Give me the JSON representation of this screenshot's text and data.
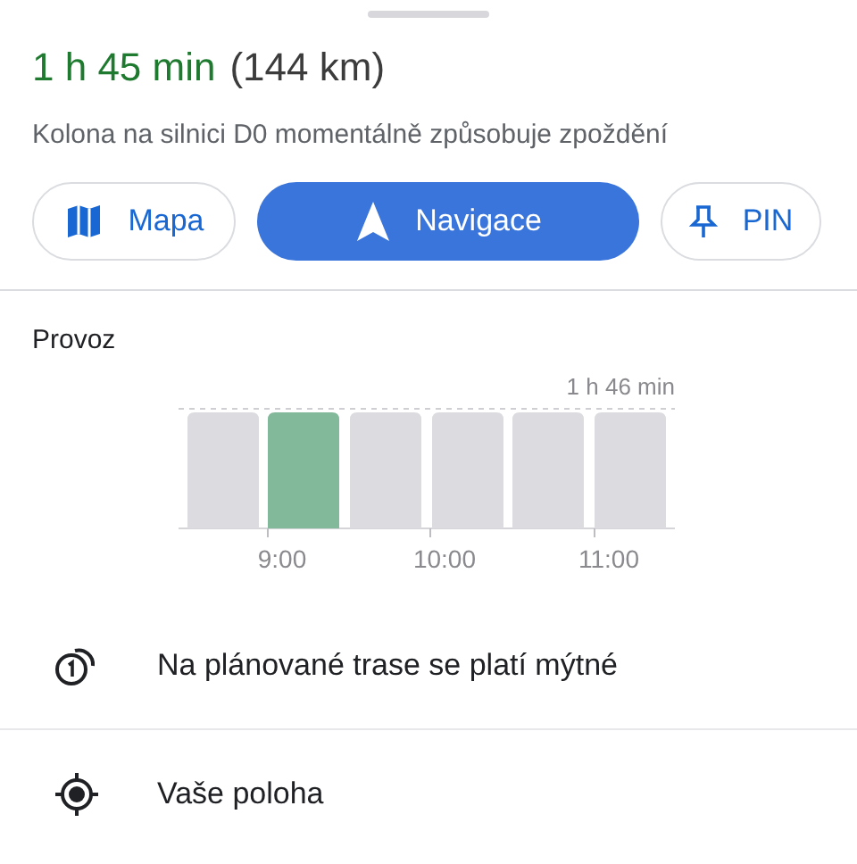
{
  "summary": {
    "duration": "1 h 45 min",
    "distance": "(144 km)",
    "note": "Kolona na silnici D0 momentálně způsobuje zpoždění"
  },
  "buttons": [
    {
      "kind": "map",
      "label": "Mapa"
    },
    {
      "kind": "navigate",
      "label": "Navigace"
    },
    {
      "kind": "pin",
      "label": "PIN"
    }
  ],
  "traffic": {
    "title": "Provoz",
    "max_label": "1 h 46 min",
    "bars": [
      {
        "selected": false
      },
      {
        "selected": true
      },
      {
        "selected": false
      },
      {
        "selected": false
      },
      {
        "selected": false
      },
      {
        "selected": false
      }
    ],
    "times": [
      "9:00",
      "10:00",
      "11:00"
    ]
  },
  "rows": [
    {
      "kind": "toll",
      "label": "Na plánované trase se platí mýtné"
    },
    {
      "kind": "location",
      "label": "Vaše poloha"
    }
  ]
}
